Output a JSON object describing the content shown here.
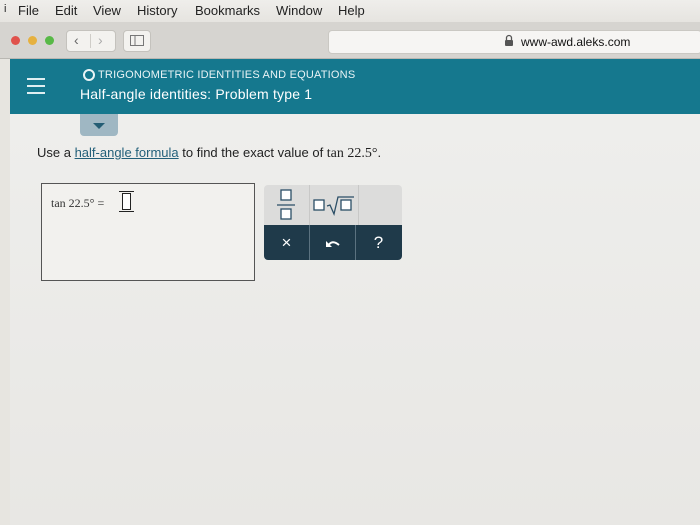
{
  "menubar": {
    "items": [
      "File",
      "Edit",
      "View",
      "History",
      "Bookmarks",
      "Window",
      "Help"
    ]
  },
  "browser": {
    "url": "www-awd.aleks.com",
    "traffic_lights": [
      "#e0524c",
      "#e6b13f",
      "#58b947"
    ]
  },
  "header": {
    "topic": "TRIGONOMETRIC IDENTITIES AND EQUATIONS",
    "problem_title": "Half-angle identities: Problem type 1",
    "accent_color": "#15788e"
  },
  "question": {
    "text_before": "Use a ",
    "link": "half-angle formula",
    "text_after": " to find the exact value of ",
    "expression": "tan 22.5°",
    "period": "."
  },
  "answer": {
    "lhs": "tan 22.5° ="
  },
  "palette": {
    "fraction_icon": "fraction-icon",
    "sqrt_icon": "square-root-icon",
    "clear_label": "×",
    "undo_icon": "undo-icon",
    "help_label": "?"
  }
}
